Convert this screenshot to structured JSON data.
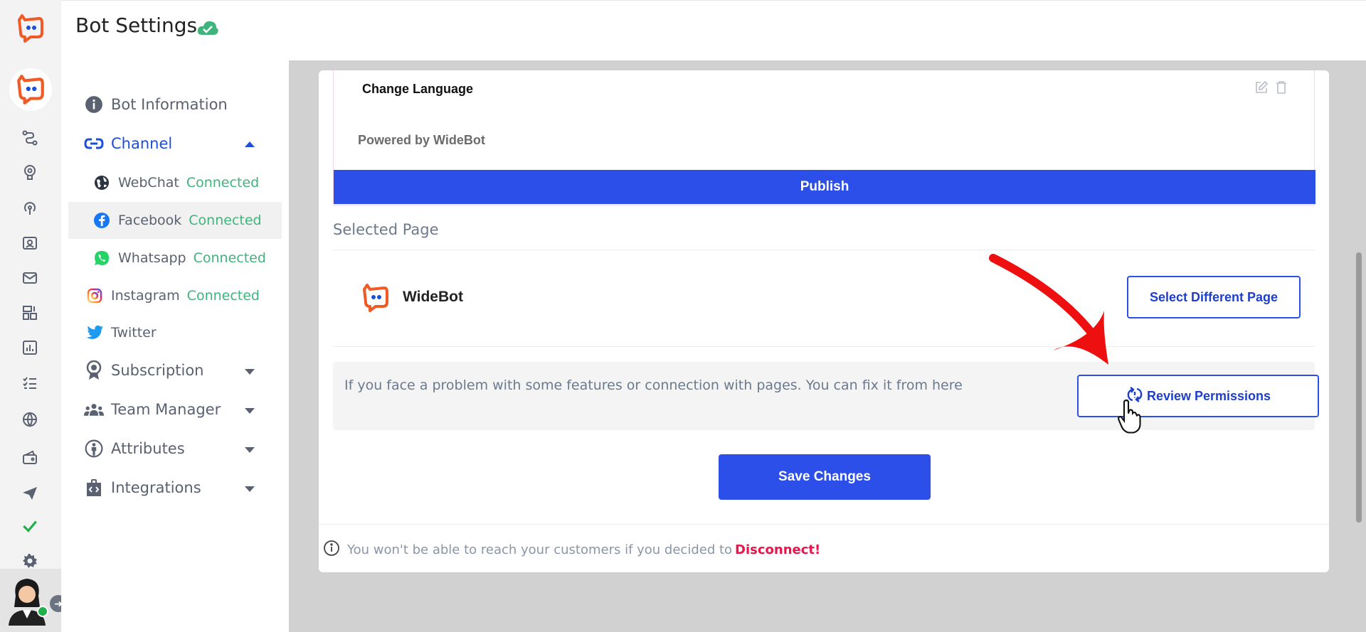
{
  "header": {
    "title": "Bot Settings"
  },
  "rail": {
    "icons": [
      "flow-icon",
      "brain-icon",
      "broadcast-icon",
      "contacts-icon",
      "mail-icon",
      "dashboard-icon",
      "analytics-icon",
      "checklist-icon",
      "globe-icon",
      "wallet-icon",
      "send-icon",
      "check-icon",
      "gear-icon"
    ]
  },
  "menu": {
    "bot_information": "Bot Information",
    "channel": "Channel",
    "channels": [
      {
        "label": "WebChat",
        "status": "Connected"
      },
      {
        "label": "Facebook",
        "status": "Connected"
      },
      {
        "label": "Whatsapp",
        "status": "Connected"
      },
      {
        "label": "Instagram",
        "status": "Connected"
      },
      {
        "label": "Twitter",
        "status": ""
      }
    ],
    "subscription": "Subscription",
    "team_manager": "Team Manager",
    "attributes": "Attributes",
    "integrations": "Integrations"
  },
  "widget": {
    "change_language": "Change Language",
    "powered_by": "Powered by WideBot",
    "publish": "Publish"
  },
  "selected_page": {
    "heading": "Selected Page",
    "page_name": "WideBot",
    "select_different": "Select Different Page"
  },
  "fix": {
    "text": "If you face a problem with some features or connection with pages. You can fix it from here",
    "review_button": "Review Permissions"
  },
  "save_button": "Save Changes",
  "warning": {
    "text": "You won't be able to reach your customers if you decided to",
    "link": "Disconnect!"
  },
  "colors": {
    "primary": "#2d4fe9",
    "connected": "#3fb47c",
    "danger": "#e8174b",
    "brand_orange": "#f05a24"
  }
}
